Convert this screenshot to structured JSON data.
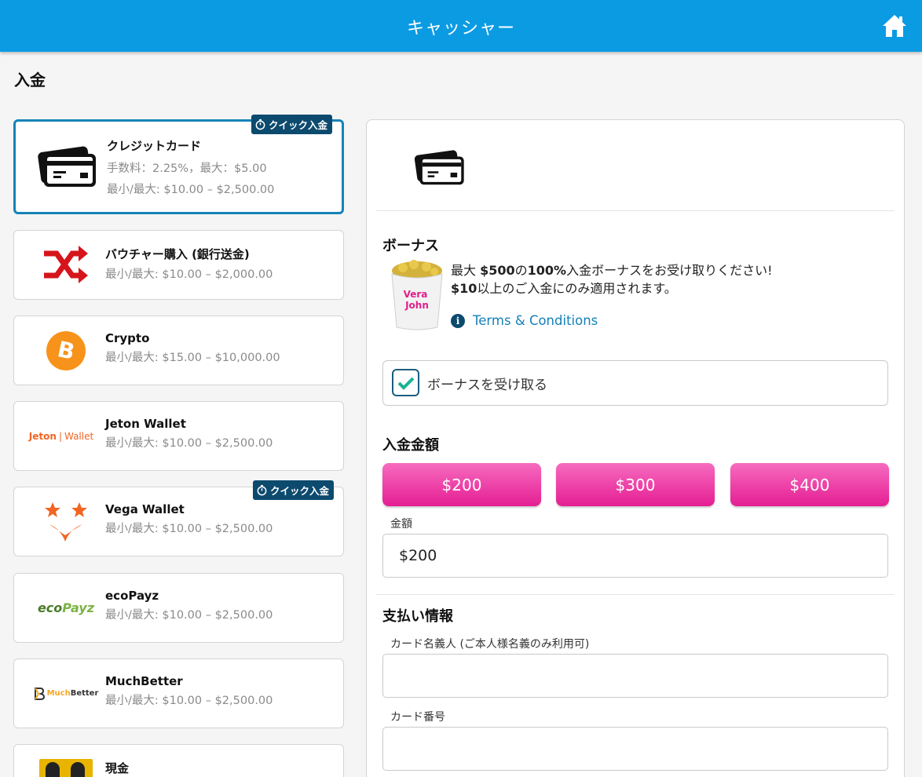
{
  "header": {
    "title": "キャッシャー"
  },
  "page": {
    "section_title": "入金"
  },
  "quick_badge": "クイック入金",
  "methods": [
    {
      "name": "クレジットカード",
      "lines": [
        "手数料：2.25%，最大：$5.00",
        "最小/最大: $10.00 – $2,500.00"
      ]
    },
    {
      "name": "バウチャー購入 (銀行送金)",
      "lines": [
        "最小/最大: $10.00 – $2,000.00"
      ]
    },
    {
      "name": "Crypto",
      "lines": [
        "最小/最大: $15.00 – $10,000.00"
      ]
    },
    {
      "name": "Jeton Wallet",
      "logo_text": [
        "Jeton",
        "Wallet"
      ],
      "lines": [
        "最小/最大: $10.00 – $2,500.00"
      ]
    },
    {
      "name": "Vega Wallet",
      "lines": [
        "最小/最大: $10.00 – $2,500.00"
      ]
    },
    {
      "name": "ecoPayz",
      "logo_text": [
        "eco",
        "Payz"
      ],
      "lines": [
        "最小/最大: $10.00 – $2,500.00"
      ]
    },
    {
      "name": "MuchBetter",
      "logo_text": [
        "Much",
        "Better"
      ],
      "lines": [
        "最小/最大: $10.00 – $2,500.00"
      ]
    },
    {
      "name": "現金",
      "lines": []
    }
  ],
  "bonus": {
    "heading": "ボーナス",
    "line1_pre": "最大 ",
    "line1_amount": "$500",
    "line1_mid": "の",
    "line1_pct": "100%",
    "line1_post": "入金ボーナスをお受け取りください!",
    "line2_amount": "$10",
    "line2_post": "以上のご入金にのみ適用されます。",
    "image_text": [
      "Vera",
      "John"
    ],
    "terms": "Terms & Conditions",
    "checkbox_label": "ボーナスを受け取る",
    "checked": true
  },
  "amount": {
    "heading": "入金金額",
    "presets": [
      "$200",
      "$300",
      "$400"
    ],
    "field_label": "金額",
    "value": "$200"
  },
  "payment": {
    "heading": "支払い情報",
    "holder_label": "カード名義人 (ご本人様名義のみ利用可)",
    "holder_value": "",
    "number_label": "カード番号",
    "number_value": ""
  },
  "colors": {
    "header": "#0b9be3",
    "accent": "#e51e93",
    "selected_border": "#1583b8",
    "link": "#1480b8"
  }
}
